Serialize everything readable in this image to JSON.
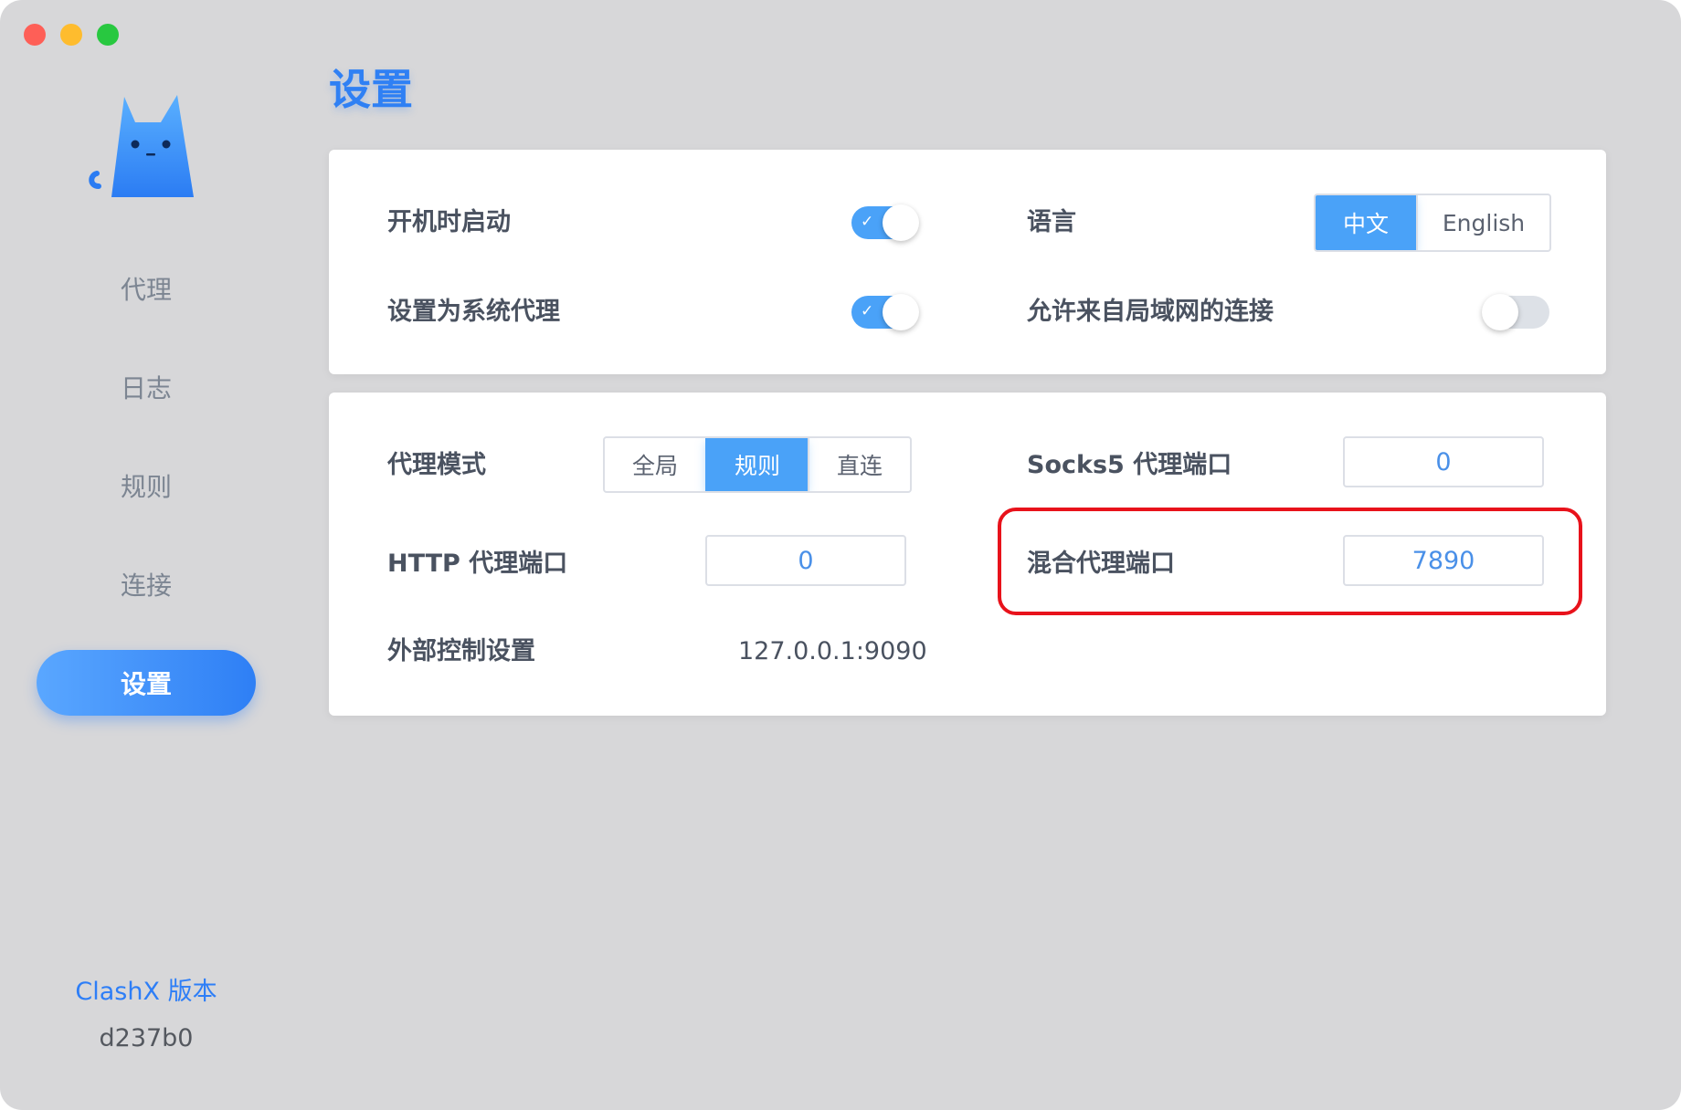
{
  "window": {
    "controls": [
      "close",
      "minimize",
      "maximize"
    ]
  },
  "sidebar": {
    "logo_icon": "cat-logo-icon",
    "items": [
      {
        "label": "代理",
        "active": false
      },
      {
        "label": "日志",
        "active": false
      },
      {
        "label": "规则",
        "active": false
      },
      {
        "label": "连接",
        "active": false
      },
      {
        "label": "设置",
        "active": true
      }
    ],
    "version_label": "ClashX 版本",
    "version_value": "d237b0"
  },
  "page": {
    "title": "设置"
  },
  "general": {
    "launch_at_login": {
      "label": "开机时启动",
      "enabled": true
    },
    "set_system_proxy": {
      "label": "设置为系统代理",
      "enabled": true
    },
    "language": {
      "label": "语言",
      "options": [
        "中文",
        "English"
      ],
      "selected": "中文"
    },
    "allow_lan": {
      "label": "允许来自局域网的连接",
      "enabled": false
    }
  },
  "proxy": {
    "mode": {
      "label": "代理模式",
      "options": [
        "全局",
        "规则",
        "直连"
      ],
      "selected": "规则"
    },
    "socks5_port": {
      "label": "Socks5 代理端口",
      "value": "0"
    },
    "http_port": {
      "label": "HTTP 代理端口",
      "value": "0"
    },
    "mixed_port": {
      "label": "混合代理端口",
      "value": "7890"
    },
    "external_controller": {
      "label": "外部控制设置",
      "value": "127.0.0.1:9090"
    }
  },
  "colors": {
    "accent": "#2f80f4",
    "toggle_on": "#4aa2f8",
    "highlight": "#e8121b"
  }
}
